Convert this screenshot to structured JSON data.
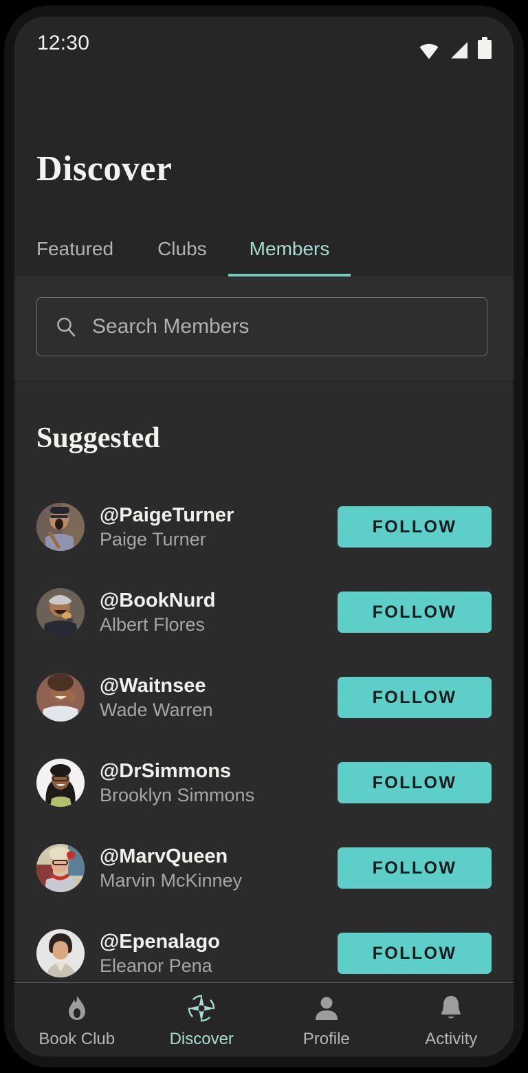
{
  "status_bar": {
    "time": "12:30",
    "icons": [
      "wifi-icon",
      "cellular-signal-icon",
      "battery-icon"
    ]
  },
  "header": {
    "title": "Discover",
    "tabs": [
      {
        "label": "Featured",
        "active": false
      },
      {
        "label": "Clubs",
        "active": false
      },
      {
        "label": "Members",
        "active": true
      }
    ]
  },
  "search": {
    "placeholder": "Search Members",
    "value": "",
    "icon": "search-icon"
  },
  "main": {
    "section_title": "Suggested",
    "follow_label": "FOLLOW",
    "members": [
      {
        "handle": "@PaigeTurner",
        "name": "Paige Turner",
        "follow_label": "FOLLOW"
      },
      {
        "handle": "@BookNurd",
        "name": "Albert Flores",
        "follow_label": "FOLLOW"
      },
      {
        "handle": "@Waitnsee",
        "name": "Wade Warren",
        "follow_label": "FOLLOW"
      },
      {
        "handle": "@DrSimmons",
        "name": "Brooklyn Simmons",
        "follow_label": "FOLLOW"
      },
      {
        "handle": "@MarvQueen",
        "name": "Marvin McKinney",
        "follow_label": "FOLLOW"
      },
      {
        "handle": "@Epenalago",
        "name": "Eleanor Pena",
        "follow_label": "FOLLOW"
      }
    ]
  },
  "bottom_nav": {
    "items": [
      {
        "label": "Book Club",
        "icon": "flame-icon",
        "active": false
      },
      {
        "label": "Discover",
        "icon": "compass-icon",
        "active": true
      },
      {
        "label": "Profile",
        "icon": "person-icon",
        "active": false
      },
      {
        "label": "Activity",
        "icon": "bell-icon",
        "active": false
      }
    ]
  },
  "colors": {
    "accent": "#5ecfc8",
    "accent_light": "#a8ddd3",
    "tab_underline": "#79c9ba",
    "screen_bg": "#2b2b2b",
    "header_bg": "#262626",
    "text_primary": "#f4f2ee",
    "text_secondary": "#a6a6a6"
  }
}
